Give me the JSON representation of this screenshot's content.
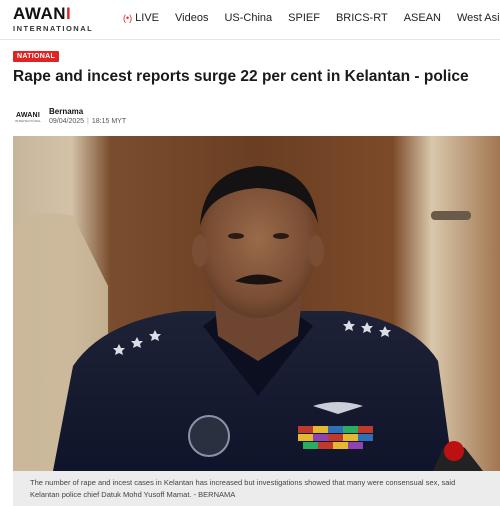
{
  "header": {
    "logo_main": "AWANI",
    "logo_sub": "INTERNATIONAL",
    "nav": [
      {
        "label": "LIVE",
        "icon": "live-broadcast-icon"
      },
      {
        "label": "Videos"
      },
      {
        "label": "US-China"
      },
      {
        "label": "SPIEF"
      },
      {
        "label": "BRICS-RT"
      },
      {
        "label": "ASEAN"
      },
      {
        "label": "West Asia"
      }
    ]
  },
  "article": {
    "category": "NATIONAL",
    "title": "Rape and incest reports surge 22 per cent in Kelantan - police",
    "author_logo_top": "AWANI",
    "author_logo_bottom": "INTERNATIONAL",
    "author": "Bernama",
    "date": "09/04/2025",
    "time": "18:15 MYT",
    "caption": "The number of rape and incest cases in Kelantan has increased but investigations showed that many were consensual sex, said Kelantan police chief Datuk Mohd Yusoff Mamat. - BERNAMA"
  },
  "colors": {
    "accent": "#e02424",
    "caption_bg": "#ececec"
  }
}
